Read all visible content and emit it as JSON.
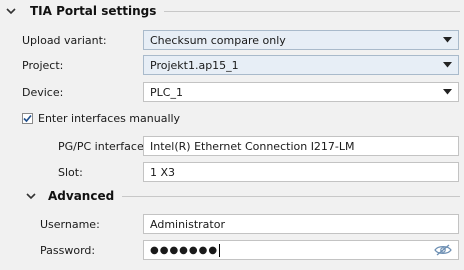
{
  "section_main": {
    "title": "TIA Portal settings"
  },
  "upload_variant": {
    "label": "Upload variant:",
    "value": "Checksum compare only"
  },
  "project": {
    "label": "Project:",
    "value": "Projekt1.ap15_1"
  },
  "device": {
    "label": "Device:",
    "value": "PLC_1"
  },
  "manual_interfaces": {
    "label": "Enter interfaces manually",
    "checked": true
  },
  "pgpc_interface": {
    "label": "PG/PC interface:",
    "value": "Intel(R) Ethernet Connection I217-LM"
  },
  "slot": {
    "label": "Slot:",
    "value": "1 X3"
  },
  "section_advanced": {
    "title": "Advanced"
  },
  "username": {
    "label": "Username:",
    "value": "Administrator"
  },
  "password": {
    "label": "Password:",
    "value": "●●●●●●●"
  },
  "icons": {
    "collapse": "chevron-down-icon",
    "dropdown": "dropdown-arrow-icon",
    "visibility": "eye-hidden-icon",
    "check": "checkmark-icon"
  }
}
